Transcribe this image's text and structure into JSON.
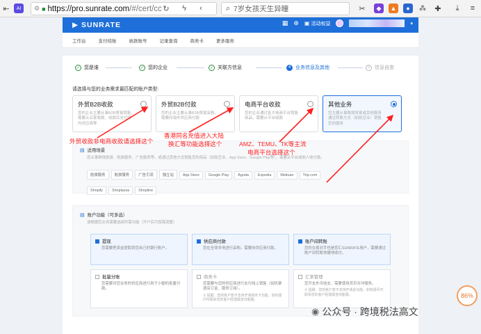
{
  "browser": {
    "url_host": "https://pro.sunrate.com",
    "url_path": "/#/cert/cc",
    "search_text": "7岁女孩天生异瞳"
  },
  "header": {
    "logo": "SUNRATE",
    "activity_label": "活动权益"
  },
  "nav": {
    "items": [
      "工作台",
      "支付结账",
      "收款账号",
      "记录查询",
      "商务卡",
      "更多服务"
    ]
  },
  "steps": [
    {
      "label": "您是谁",
      "state": "done"
    },
    {
      "label": "您的企业",
      "state": "done"
    },
    {
      "label": "关联方信息",
      "state": "done"
    },
    {
      "num": "4",
      "label": "业务信息及其他",
      "state": "active"
    },
    {
      "num": "5",
      "label": "信息自查",
      "state": "todo"
    }
  ],
  "prompt": "请选择与您的业务需求最匹配的账户类型:",
  "account_types": [
    {
      "title": "外贸B2B收款",
      "desc": "您的企业主要从事B2B贸易销售，需要从买家收款、收款后支付境内供应商等",
      "selected": false
    },
    {
      "title": "外贸B2B付款",
      "desc": "您的企业主要从事B2B贸易采购，需要向海外供应商付款",
      "selected": false
    },
    {
      "title": "电商平台收款",
      "desc": "您的企业通过各大电商平台销售商品，需要从平台收款",
      "selected": false
    },
    {
      "title": "其他业务",
      "desc": "您主要从事跨境贸易或其他服务通过转账方式（如航空业）销售您的服务",
      "selected": true
    }
  ],
  "scenario": {
    "title": "适用场景",
    "desc": "您从事跨境旅游、航旅服务、广告服务等，或通过其他方式销售您的商品（如航空业、App Store、Google Play等），需要从平台或他人收付款。",
    "tags_row1": [
      "航旅服务",
      "航旅服务",
      "广告引流",
      "独立站",
      "App Store",
      "Google Play",
      "Agoda",
      "Expedia",
      "Meituan",
      "Trip.com"
    ],
    "tags_row2": [
      "Shopify",
      "Shoplazza",
      "Shopline"
    ]
  },
  "functions": {
    "title": "账户功能（可多选）",
    "desc": "请根据您业务需要选择所需功能（开户后可按需调整）",
    "cards": [
      {
        "title": "提现",
        "desc": "您需要把资金提取到您自己的银行账户。",
        "note": "",
        "checked": true
      },
      {
        "title": "供应商付款",
        "desc": "您在全球多地进行采购，需要向供应商付款。",
        "note": "",
        "checked": true
      },
      {
        "title": "账户间转账",
        "desc": "您的交易对手也是您汇SUNRATE用户，需要通过账户间转账快捷地收付。",
        "note": "",
        "checked": true
      },
      {
        "title": "批量分账",
        "desc": "您需要对您业务的供应商进行用于小额的批量付款。",
        "note": "",
        "checked": false
      },
      {
        "title": "商务卡",
        "desc": "您需要与您的供应商进行支付线上销售（如机票酒店订金、服务订阅）。",
        "note": "① 提醒：您的账户暂不支持开通商务卡功能，如有疑问可联系您的客户经理或咨询客服。",
        "checked": false
      },
      {
        "title": "汇率管理",
        "desc": "您开支外币收支，需要使用货币对冲服务。",
        "note": "① 提醒：您的账户暂不支持开通此功能，如有疑问可联系您的客户经理或咨询客服。",
        "checked": false
      }
    ]
  },
  "annotations": {
    "note1": "外贸收款非电商收款请选择这个",
    "note2_line1": "香港同名充值进入大陆",
    "note2_line2": "换汇等功能选择这个",
    "note3_line1": "AMZ、TEMU、TK等主流",
    "note3_line2": "电商平台选择这个"
  },
  "watermark": "公众号 · 跨境税法高文",
  "progress_badge": "86%",
  "colors": {
    "brand": "#1e6fd9",
    "annotation": "#ff2020",
    "done": "#2a8a3a"
  }
}
